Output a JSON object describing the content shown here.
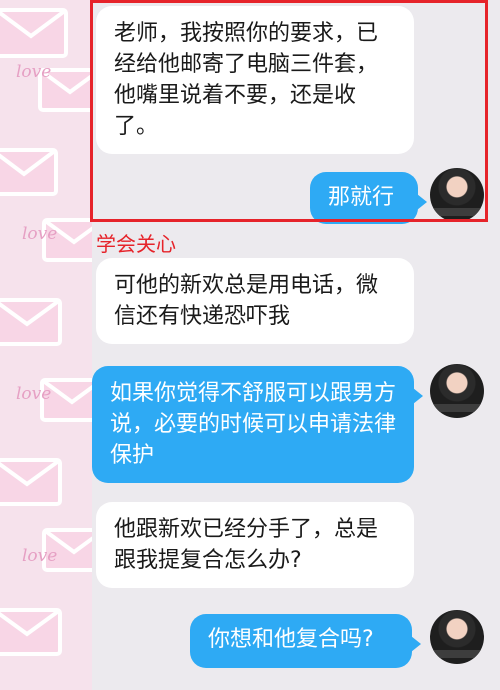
{
  "section_label": "学会关心",
  "messages": [
    {
      "side": "left",
      "text": "老师，我按照你的要求，已经给他邮寄了电脑三件套，他嘴里说着不要，还是收了。"
    },
    {
      "side": "right",
      "text": "那就行"
    },
    {
      "side": "left",
      "text": "可他的新欢总是用电话，微信还有快递恐吓我"
    },
    {
      "side": "right",
      "text": "如果你觉得不舒服可以跟男方说，必要的时候可以申请法律保护"
    },
    {
      "side": "left",
      "text": "他跟新欢已经分手了，总是跟我提复合怎么办?"
    },
    {
      "side": "right",
      "text": "你想和他复合吗?"
    }
  ],
  "decor": {
    "love_word": "love"
  },
  "colors": {
    "highlight": "#e6232a",
    "bubble_blue": "#2eaaf4",
    "bubble_white": "#ffffff"
  }
}
